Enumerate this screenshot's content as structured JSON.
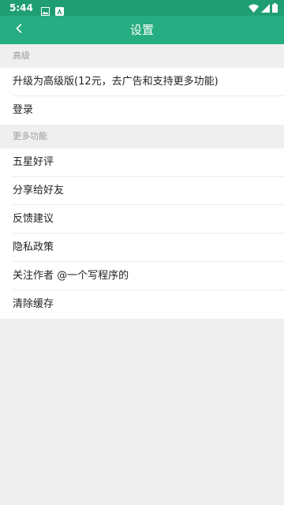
{
  "status_bar": {
    "time": "5:44",
    "icons": [
      "image-notification-icon",
      "app-notification-icon",
      "wifi-icon",
      "cellular-signal-icon",
      "battery-icon"
    ]
  },
  "toolbar": {
    "title": "设置",
    "back_icon": "chevron-left-icon"
  },
  "sections": [
    {
      "header": "高级",
      "items": [
        "升级为高级版(12元，去广告和支持更多功能)",
        "登录"
      ]
    },
    {
      "header": "更多功能",
      "items": [
        "五星好评",
        "分享给好友",
        "反馈建议",
        "隐私政策",
        "关注作者 @一个写程序的",
        "清除缓存"
      ]
    }
  ],
  "colors": {
    "status_bar": "#1f9e74",
    "toolbar": "#26ad82",
    "background": "#efefef"
  }
}
